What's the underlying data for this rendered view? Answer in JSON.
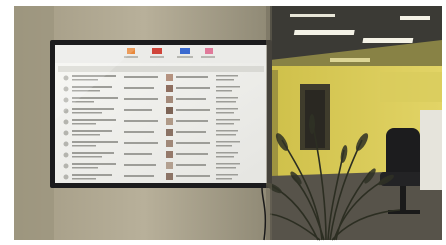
{
  "scene": {
    "colors": {
      "wall": "#b0a892",
      "wall_shadow": "#8a846f",
      "glass_room": "#d4c84a",
      "ceiling": "#efeee4",
      "floor": "#4a473f",
      "tv_bezel": "#1b1b1d",
      "screen": "#f1f1ef",
      "plant": "#2e2f24",
      "chair": "#1c1c1e"
    },
    "tv_screen": {
      "tabs": [
        "orange-tab-icon",
        "red-tab-icon",
        "blue-tab-icon",
        "pink-tab-icon"
      ],
      "column_count": 4,
      "row_count": 10
    }
  }
}
